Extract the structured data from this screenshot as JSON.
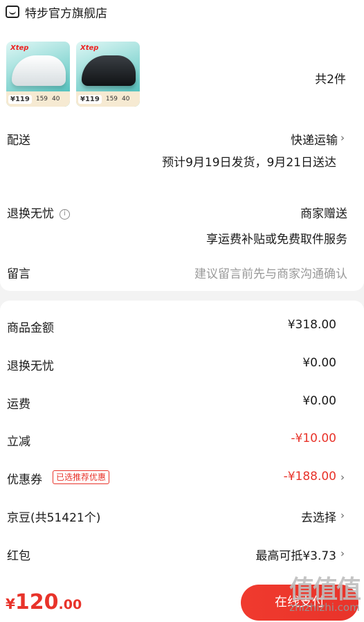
{
  "store": {
    "name": "特步官方旗舰店"
  },
  "products": [
    {
      "brand": "Xtep",
      "price_tag": "¥119",
      "small1": "159",
      "small2": "40"
    },
    {
      "brand": "Xtep",
      "price_tag": "¥119",
      "small1": "159",
      "small2": "40"
    }
  ],
  "items_count": "共2件",
  "delivery": {
    "label": "配送",
    "method": "快递运输",
    "estimate": "预计9月19日发货，9月21日送达"
  },
  "returns": {
    "label": "退换无忧",
    "info_icon": "i",
    "value": "商家赠送",
    "subtext": "享运费补贴或免费取件服务"
  },
  "message": {
    "label": "留言",
    "placeholder": "建议留言前先与商家沟通确认"
  },
  "summary": {
    "goods_label": "商品金额",
    "goods_value": "¥318.00",
    "returns_label": "退换无忧",
    "returns_value": "¥0.00",
    "shipping_label": "运费",
    "shipping_value": "¥0.00",
    "discount_label": "立减",
    "discount_value": "-¥10.00",
    "coupon_label": "优惠券",
    "coupon_tag": "已选推荐优惠",
    "coupon_value": "-¥188.00",
    "jingdou_label": "京豆(共51421个)",
    "jingdou_value": "去选择",
    "redpacket_label": "红包",
    "redpacket_value": "最高可抵¥3.73"
  },
  "footer": {
    "currency": "¥",
    "total_int": "120",
    "total_dec": ".00",
    "pay_button": "在线支付"
  },
  "watermark": {
    "logo": "值值值",
    "url": "zhizhizhi.com"
  },
  "colors": {
    "accent": "#e8332a",
    "background": "#f3f3f3"
  }
}
